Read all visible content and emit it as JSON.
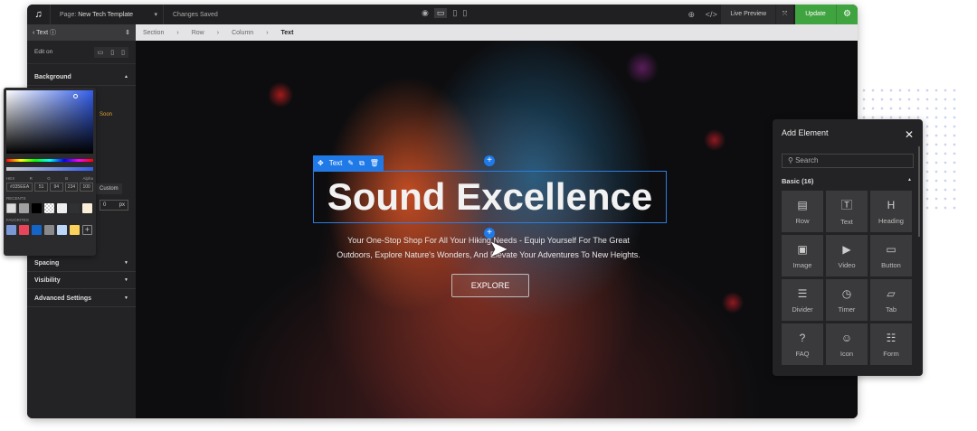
{
  "topbar": {
    "page_label": "Page:",
    "page_name": "New Tech Template",
    "status": "Changes Saved",
    "live_preview": "Live Preview",
    "update": "Update"
  },
  "left_panel": {
    "title": "Text",
    "edit_on": "Edit on",
    "sections": [
      "Background",
      "Spacing",
      "Visibility",
      "Advanced Settings"
    ],
    "coming_soon": "Soon",
    "custom": "Custom",
    "px_value": "0",
    "px_unit": "px"
  },
  "breadcrumb": [
    "Section",
    "Row",
    "Column",
    "Text"
  ],
  "color_picker": {
    "labels": [
      "HEX",
      "R",
      "G",
      "B",
      "Alpha"
    ],
    "values": [
      "#335EEA",
      "51",
      "94",
      "234",
      "100"
    ],
    "recents_label": "RECENTS",
    "recents": [
      "none",
      "#a0a0a0",
      "#000000",
      "transparent",
      "#eeeeee",
      "#2f3133",
      "#fbeed9"
    ],
    "favorites_label": "FAVORITES",
    "favorites": [
      "#7a97d6",
      "#e8455a",
      "#1565c8",
      "#8a8a8c",
      "#bcd6f7",
      "#fbd15b"
    ]
  },
  "canvas": {
    "element_tag": "Text",
    "headline": "Sound Excellence",
    "subtext_line1": "Your One-Stop Shop For All Your Hiking Needs - Equip Yourself For The Great",
    "subtext_line2": "Outdoors, Explore Nature's Wonders, And Elevate Your Adventures To New Heights.",
    "button": "EXPLORE"
  },
  "add_element": {
    "title": "Add Element",
    "search_placeholder": "Search",
    "category": "Basic (16)",
    "items": [
      {
        "label": "Row",
        "icon": "▤"
      },
      {
        "label": "Text",
        "icon": "🅃"
      },
      {
        "label": "Heading",
        "icon": "H"
      },
      {
        "label": "Image",
        "icon": "▣"
      },
      {
        "label": "Video",
        "icon": "▶"
      },
      {
        "label": "Button",
        "icon": "▭"
      },
      {
        "label": "Divider",
        "icon": "☰"
      },
      {
        "label": "Timer",
        "icon": "◷"
      },
      {
        "label": "Tab",
        "icon": "▱"
      },
      {
        "label": "FAQ",
        "icon": "?"
      },
      {
        "label": "Icon",
        "icon": "☺"
      },
      {
        "label": "Form",
        "icon": "☷"
      }
    ]
  },
  "colors": {
    "accent": "#1f7ae8",
    "update": "#3fa33f"
  }
}
